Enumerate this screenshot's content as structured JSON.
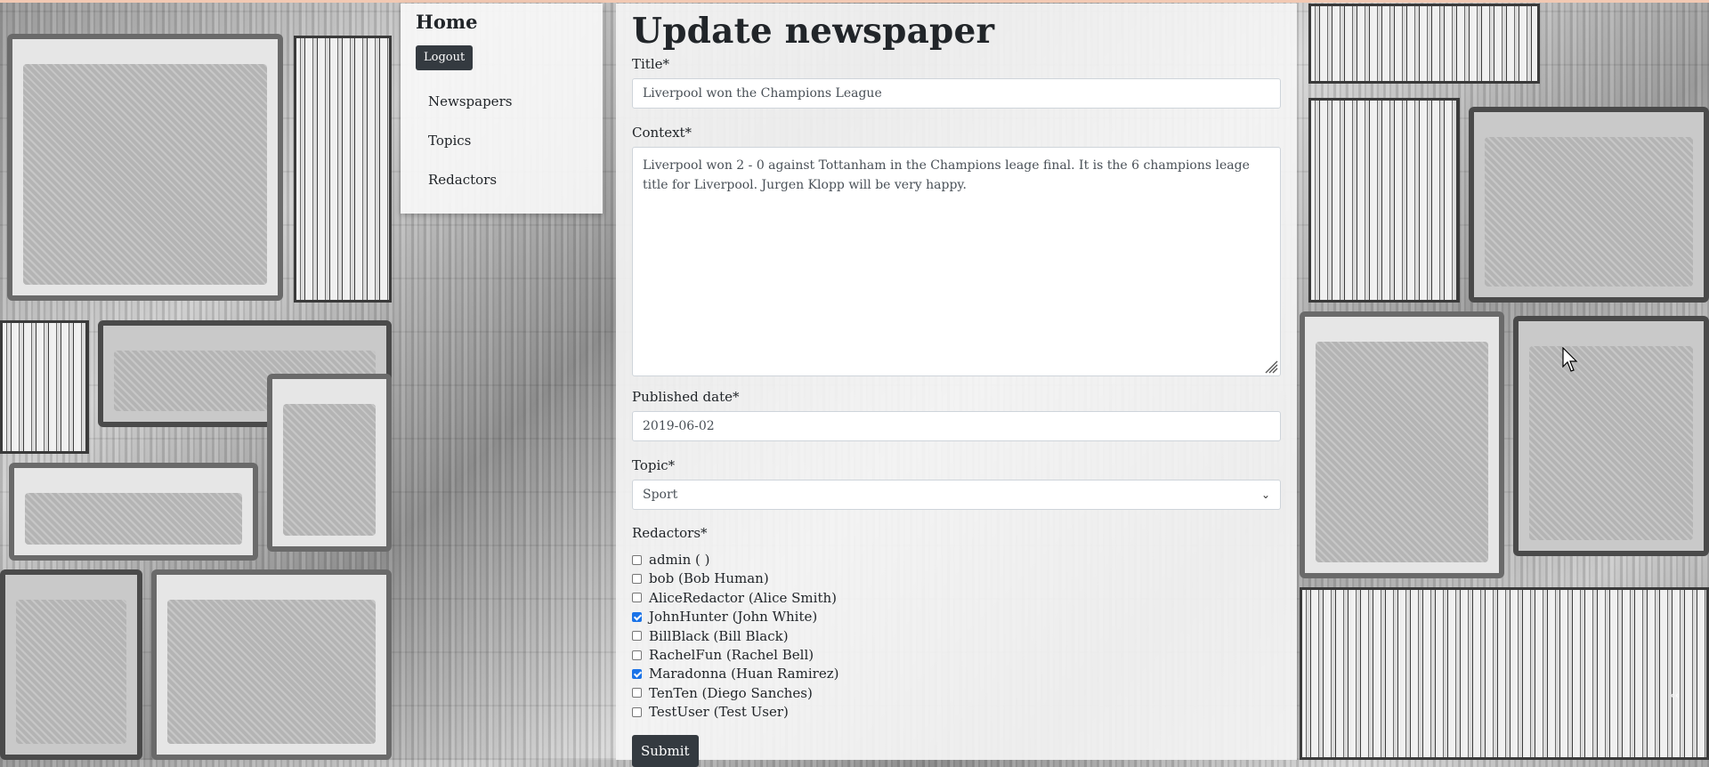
{
  "nav": {
    "home_label": "Home",
    "logout_label": "Logout",
    "links": [
      "Newspapers",
      "Topics",
      "Redactors"
    ]
  },
  "form": {
    "heading": "Update newspaper",
    "title_label": "Title*",
    "title_value": "Liverpool won the Champions League",
    "context_label": "Context*",
    "context_value": "Liverpool won 2 - 0 against Tottanham in the Champions leage final. It is the 6 champions leage title for Liverpool. Jurgen Klopp will be very happy.",
    "published_label": "Published date*",
    "published_value": "2019-06-02",
    "topic_label": "Topic*",
    "topic_value": "Sport",
    "redactors_label": "Redactors*",
    "redactors": [
      {
        "label": "admin ( )",
        "checked": false
      },
      {
        "label": "bob (Bob Human)",
        "checked": false
      },
      {
        "label": "AliceRedactor (Alice Smith)",
        "checked": false
      },
      {
        "label": "JohnHunter (John White)",
        "checked": true
      },
      {
        "label": "BillBlack (Bill Black)",
        "checked": false
      },
      {
        "label": "RachelFun (Rachel Bell)",
        "checked": false
      },
      {
        "label": "Maradonna (Huan Ramirez)",
        "checked": true
      },
      {
        "label": "TenTen (Diego Sanches)",
        "checked": false
      },
      {
        "label": "TestUser (Test User)",
        "checked": false
      }
    ],
    "submit_label": "Submit"
  },
  "colors": {
    "dark_button": "#343a40",
    "checkbox_checked": "#1a73e8"
  }
}
